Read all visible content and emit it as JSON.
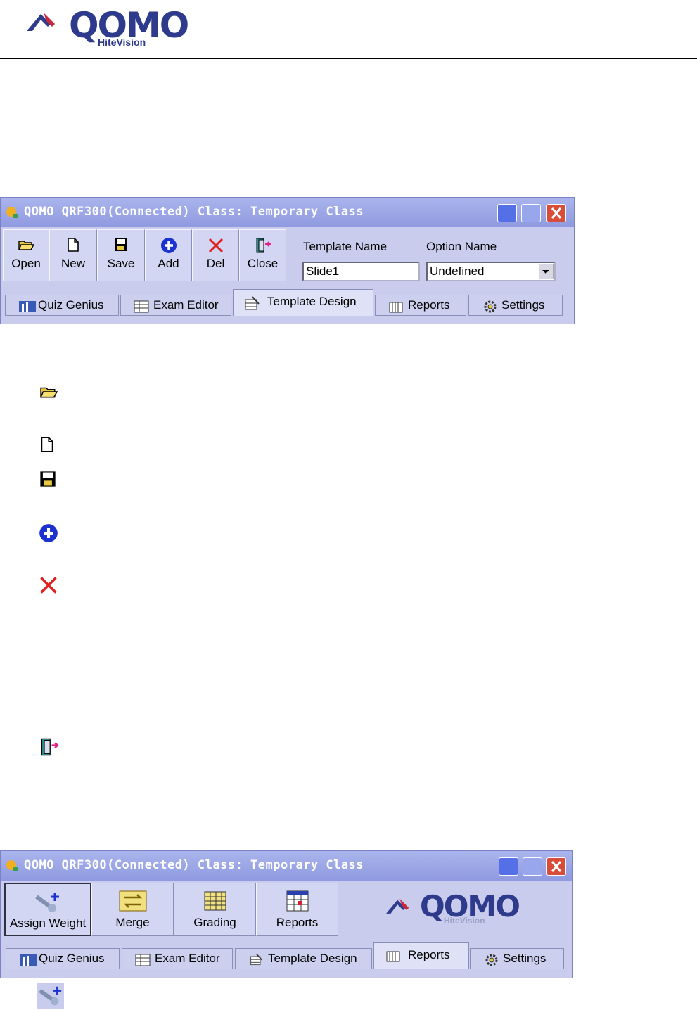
{
  "header": {
    "logo_main": "QOMO",
    "logo_sub": "HiteVision"
  },
  "window1": {
    "title": "QOMO QRF300(Connected) Class: Temporary Class",
    "toolbar": [
      {
        "label": "Open",
        "icon": "open-folder-icon"
      },
      {
        "label": "New",
        "icon": "new-document-icon"
      },
      {
        "label": "Save",
        "icon": "save-disk-icon"
      },
      {
        "label": "Add",
        "icon": "add-plus-icon"
      },
      {
        "label": "Del",
        "icon": "delete-x-icon"
      },
      {
        "label": "Close",
        "icon": "close-door-icon"
      }
    ],
    "template_name_label": "Template Name",
    "template_name_value": "Slide1",
    "option_name_label": "Option Name",
    "option_name_value": "Undefined",
    "tabs": [
      {
        "label": "Quiz Genius"
      },
      {
        "label": "Exam Editor"
      },
      {
        "label": "Template Design",
        "active": true
      },
      {
        "label": "Reports"
      },
      {
        "label": "Settings"
      }
    ]
  },
  "legend_icons": [
    "open-folder-icon",
    "new-document-icon",
    "save-disk-icon",
    "add-plus-icon",
    "delete-x-icon",
    "close-door-icon"
  ],
  "window2": {
    "title": "QOMO QRF300(Connected) Class: Temporary Class",
    "toolbar": [
      {
        "label": "Assign Weight",
        "icon": "assign-weight-icon"
      },
      {
        "label": "Merge",
        "icon": "merge-icon"
      },
      {
        "label": "Grading",
        "icon": "grading-icon"
      },
      {
        "label": "Reports",
        "icon": "reports-icon"
      }
    ],
    "logo_main": "QOMO",
    "logo_sub": "HiteVision",
    "tabs": [
      {
        "label": "Quiz Genius"
      },
      {
        "label": "Exam Editor"
      },
      {
        "label": "Template Design"
      },
      {
        "label": "Reports",
        "active": true
      },
      {
        "label": "Settings"
      }
    ]
  },
  "colors": {
    "brand": "#2e3a8c",
    "window_bg": "#c9ccec",
    "titlebar": "#8f9ae0"
  }
}
